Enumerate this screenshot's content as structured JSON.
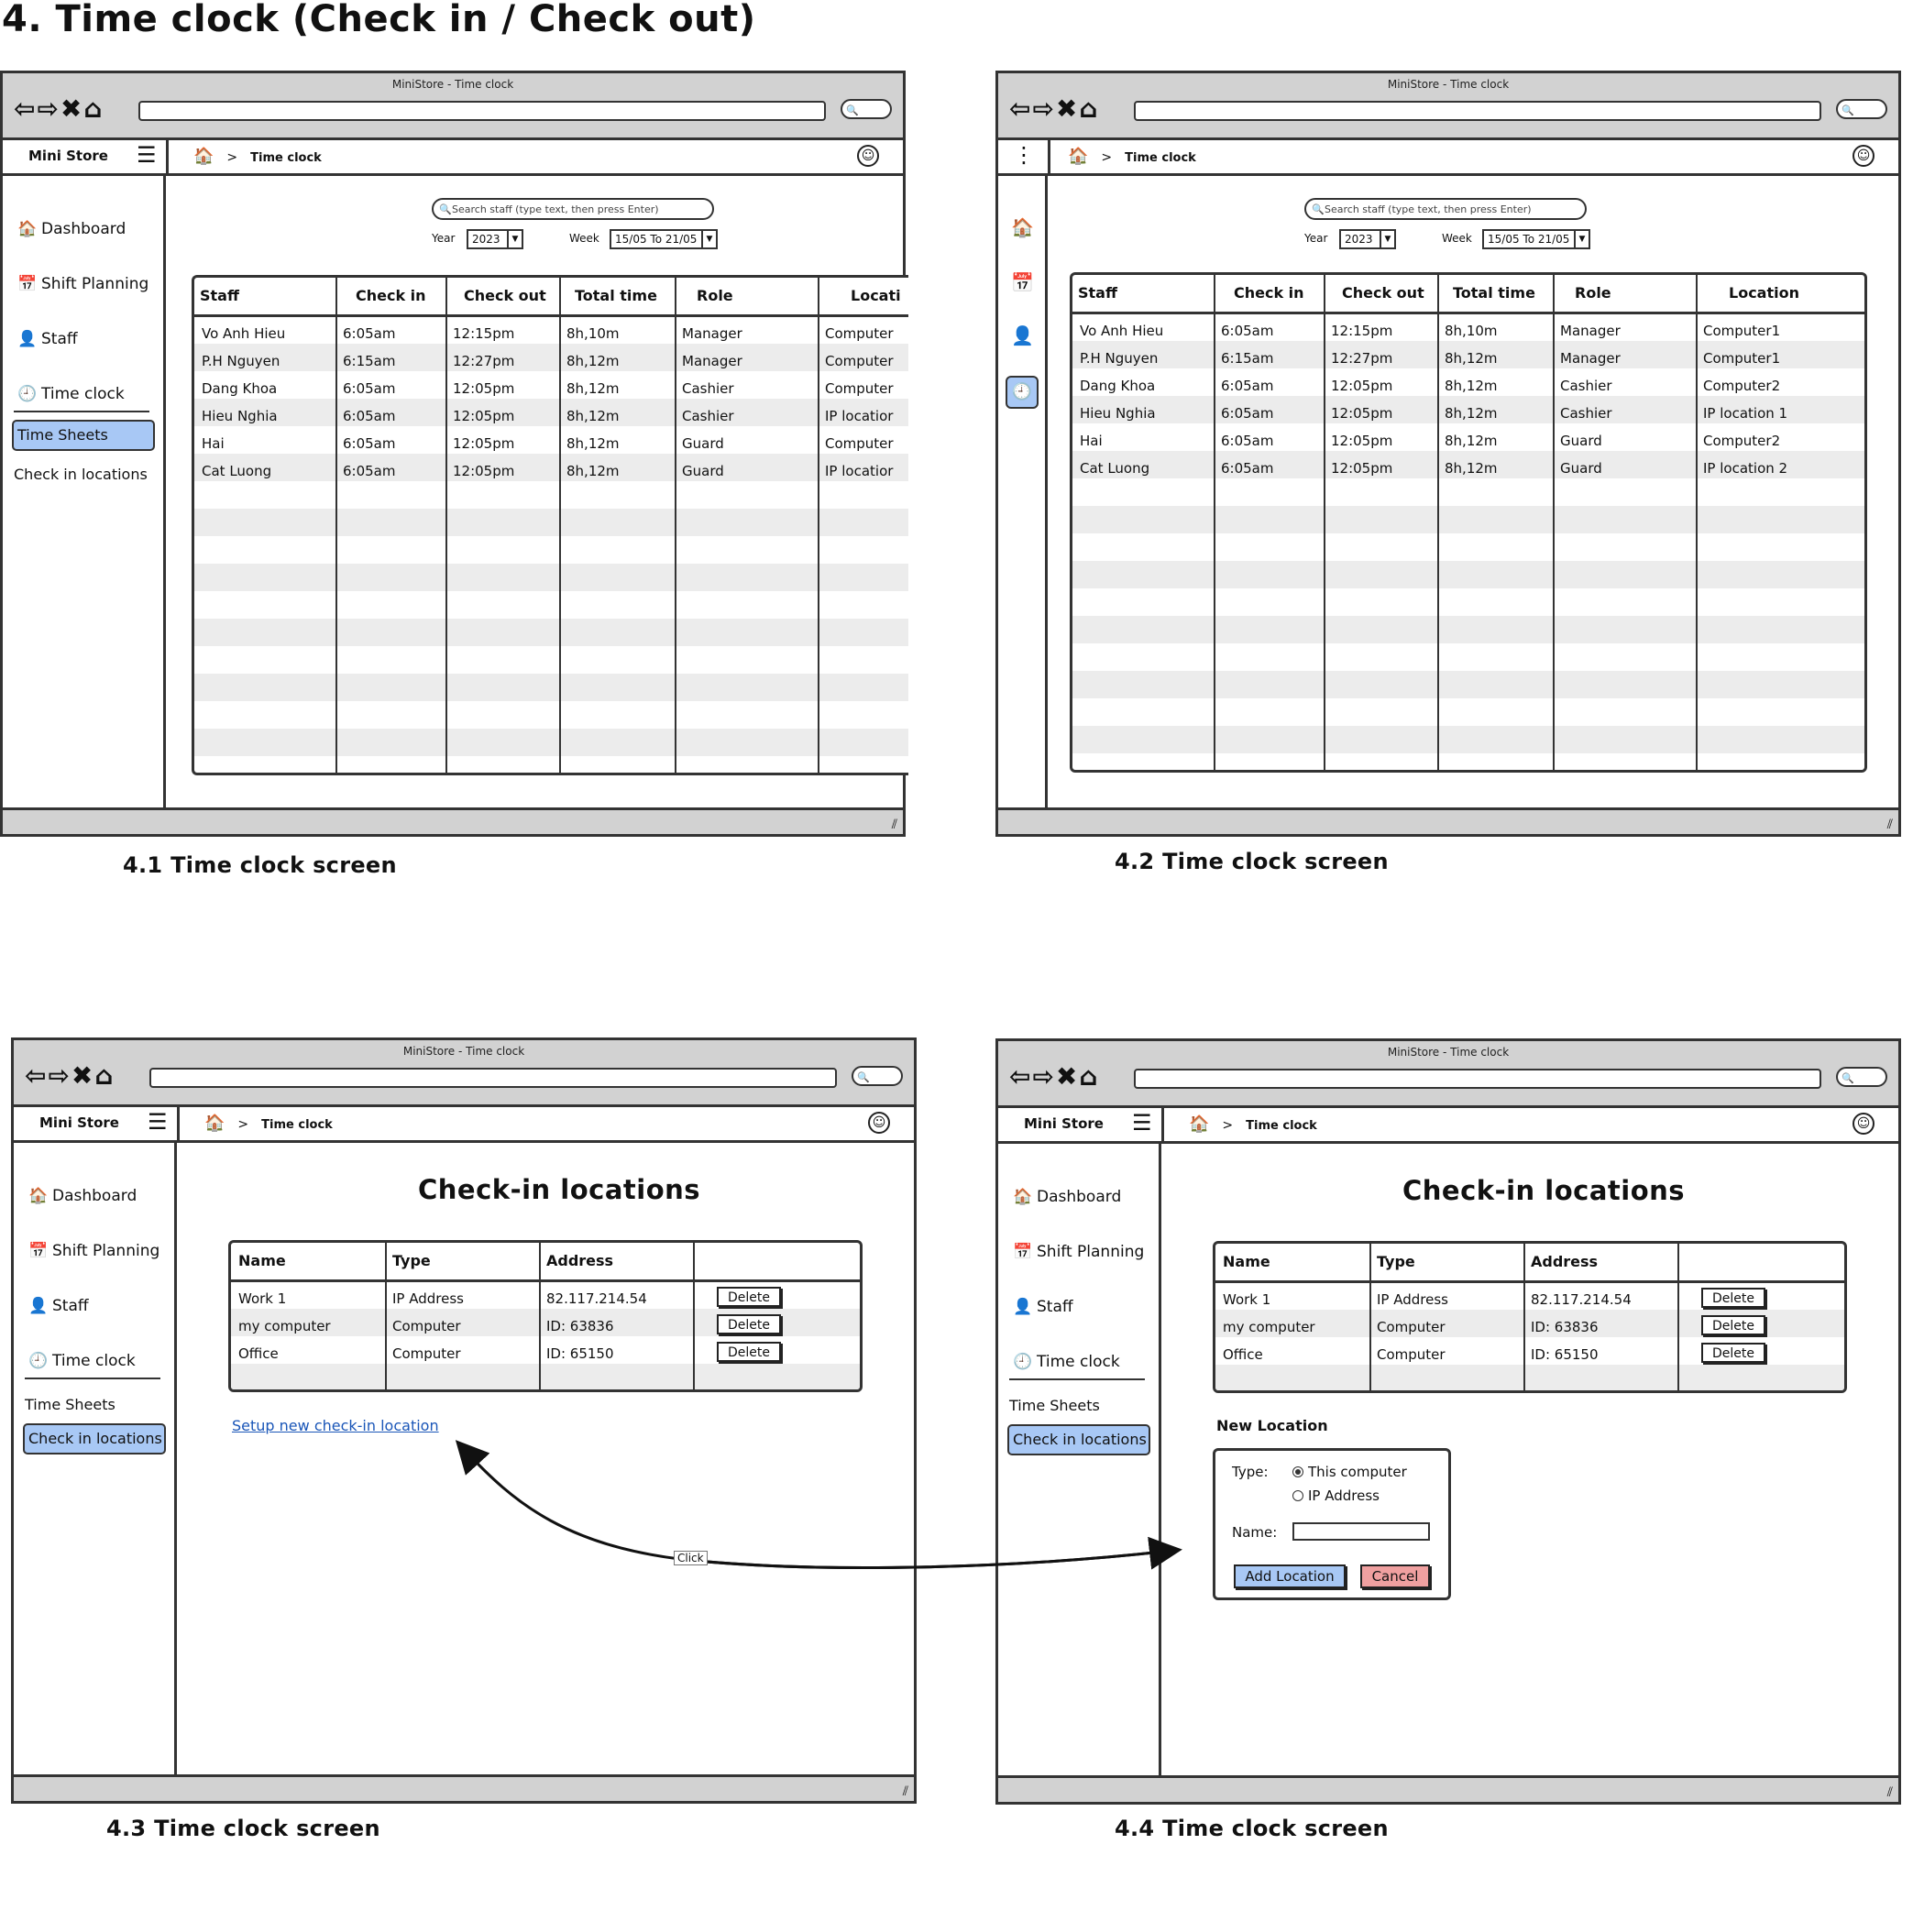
{
  "page_title": "4. Time clock (Check in / Check out)",
  "window": {
    "title": "MiniStore - Time clock",
    "nav_icons": "⇦⇨✖⌂",
    "search_pill": "🔍"
  },
  "app": {
    "brand": "Mini Store",
    "menu_icon": "☰",
    "kebab_icon": "⋮",
    "breadcrumb_home_icon": "🏠",
    "breadcrumb_chevron": ">",
    "breadcrumb_current": "Time clock"
  },
  "sidebar": {
    "items": [
      {
        "icon": "🏠",
        "label": "Dashboard"
      },
      {
        "icon": "📅",
        "label": "Shift Planning"
      },
      {
        "icon": "👤",
        "label": "Staff"
      },
      {
        "icon": "🕘",
        "label": "Time clock"
      }
    ],
    "sub_items": [
      "Time Sheets",
      "Check in locations"
    ]
  },
  "time_clock": {
    "search_placeholder": "Search staff (type text, then press Enter)",
    "year_label": "Year",
    "year_value": "2023",
    "week_label": "Week",
    "week_value": "15/05 To 21/05",
    "columns": [
      "Staff",
      "Check in",
      "Check out",
      "Total time",
      "Role",
      "Location"
    ],
    "rows_4_1": [
      [
        "Vo Anh Hieu",
        "6:05am",
        "12:15pm",
        "8h,10m",
        "Manager",
        "Computer"
      ],
      [
        "P.H Nguyen",
        "6:15am",
        "12:27pm",
        "8h,12m",
        "Manager",
        "Computer"
      ],
      [
        "Dang Khoa",
        "6:05am",
        "12:05pm",
        "8h,12m",
        "Cashier",
        "Computer"
      ],
      [
        "Hieu Nghia",
        "6:05am",
        "12:05pm",
        "8h,12m",
        "Cashier",
        "IP locatior"
      ],
      [
        "Hai",
        "6:05am",
        "12:05pm",
        "8h,12m",
        "Guard",
        "Computer"
      ],
      [
        "Cat Luong",
        "6:05am",
        "12:05pm",
        "8h,12m",
        "Guard",
        "IP locatior"
      ]
    ],
    "rows_4_2": [
      [
        "Vo Anh Hieu",
        "6:05am",
        "12:15pm",
        "8h,10m",
        "Manager",
        "Computer1"
      ],
      [
        "P.H Nguyen",
        "6:15am",
        "12:27pm",
        "8h,12m",
        "Manager",
        "Computer1"
      ],
      [
        "Dang Khoa",
        "6:05am",
        "12:05pm",
        "8h,12m",
        "Cashier",
        "Computer2"
      ],
      [
        "Hieu Nghia",
        "6:05am",
        "12:05pm",
        "8h,12m",
        "Cashier",
        "IP location 1"
      ],
      [
        "Hai",
        "6:05am",
        "12:05pm",
        "8h,12m",
        "Guard",
        "Computer2"
      ],
      [
        "Cat Luong",
        "6:05am",
        "12:05pm",
        "8h,12m",
        "Guard",
        "IP location 2"
      ]
    ],
    "header_4_1_location": "Locati"
  },
  "check_in_locations": {
    "title": "Check-in locations",
    "columns": [
      "Name",
      "Type",
      "Address"
    ],
    "rows": [
      [
        "Work 1",
        "IP Address",
        "82.117.214.54"
      ],
      [
        "my computer",
        "Computer",
        "ID: 63836"
      ],
      [
        "Office",
        "Computer",
        "ID: 65150"
      ]
    ],
    "delete_label": "Delete",
    "setup_link": "Setup new check-in location",
    "click_label": "Click"
  },
  "new_location": {
    "title": "New Location",
    "type_label": "Type:",
    "option_computer": "This computer",
    "option_ip": "IP Address",
    "selected": "This computer",
    "name_label": "Name:",
    "name_value": "",
    "add_button": "Add Location",
    "cancel_button": "Cancel",
    "add_color": "#a8c8f5",
    "cancel_color": "#f0a0a0"
  },
  "captions": [
    "4.1 Time clock screen",
    "4.2 Time clock screen",
    "4.3 Time clock screen",
    "4.4 Time clock screen"
  ],
  "colors": {
    "accent": "#a8c8f5",
    "chrome": "#d2d2d2",
    "stripe": "#ececec",
    "link": "#1a56b8"
  }
}
